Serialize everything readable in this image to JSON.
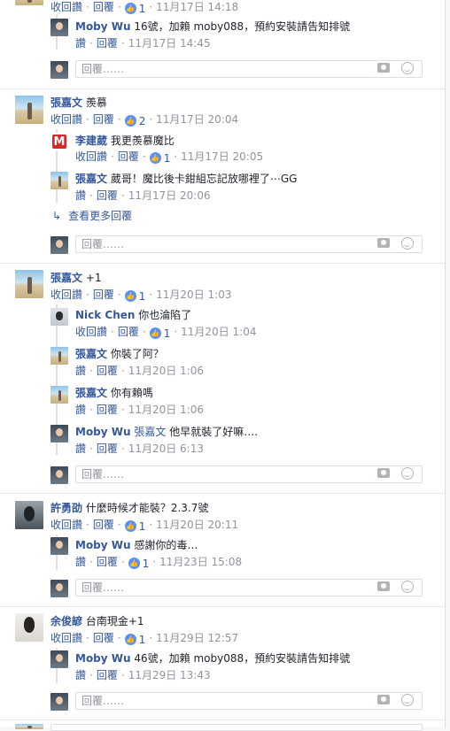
{
  "actions": {
    "unlike": "收回讚",
    "like": "讚",
    "reply": "回覆",
    "sep": "·"
  },
  "reply_placeholder": "回覆……",
  "view_more": "查看更多回覆",
  "comments": [
    {
      "meta_top": {
        "likes": "1",
        "time": "11月17日 14:18"
      }
    },
    {
      "name": "Moby Wu",
      "text": "16號，加賴 moby088，預約安裝請告知排號",
      "time": "11月17日 14:45"
    },
    {
      "name": "張嘉文",
      "text": "羨慕",
      "likes": "2",
      "time": "11月17日 20:04"
    },
    {
      "name": "李建葳",
      "text": "我更羨慕魔比",
      "likes": "1",
      "time": "11月17日 20:05"
    },
    {
      "name": "張嘉文",
      "text": "葳哥！魔比後卡鉗組忘記放哪裡了⋯GG",
      "time": "11月17日 20:06"
    },
    {
      "name": "張嘉文",
      "text": "+1",
      "likes": "1",
      "time": "11月20日 1:03"
    },
    {
      "name": "Nick Chen",
      "text": "你也淪陷了",
      "likes": "1",
      "time": "11月20日 1:04"
    },
    {
      "name": "張嘉文",
      "text": "你裝了阿？",
      "time": "11月20日 1:06"
    },
    {
      "name": "張嘉文",
      "text": "你有賴嗎",
      "time": "11月20日 1:06"
    },
    {
      "name": "Moby Wu",
      "tag": "張嘉文",
      "text": "他早就裝了好嘛….",
      "time": "11月20日 6:13"
    },
    {
      "name": "許勇劭",
      "text": "什麼時候才能裝？2.3.7號",
      "likes": "1",
      "time": "11月20日 20:11"
    },
    {
      "name": "Moby Wu",
      "text": "感謝你的毒…",
      "likes": "1",
      "time": "11月23日 15:08"
    },
    {
      "name": "余俊諺",
      "text": "台南現金+1",
      "likes": "1",
      "time": "11月29日 12:57"
    },
    {
      "name": "Moby Wu",
      "text": "46號，加賴 moby088，預約安裝請告知排號",
      "time": "11月29日 13:43"
    }
  ],
  "colors": {
    "link": "#365899",
    "meta": "#90949c",
    "like_badge": "#5890ff"
  }
}
